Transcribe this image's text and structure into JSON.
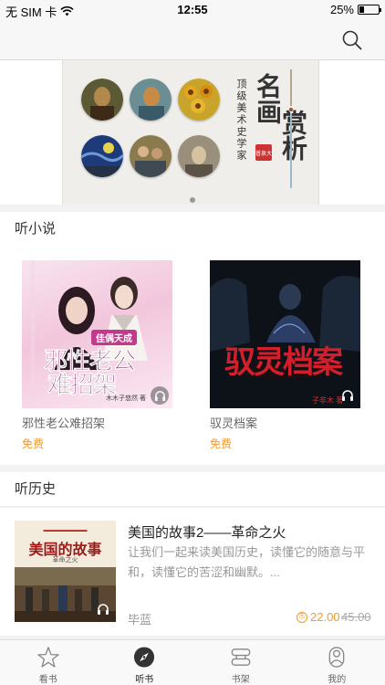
{
  "status_bar": {
    "carrier": "无 SIM 卡",
    "time": "12:55",
    "battery_text": "25%",
    "battery_level": 0.25
  },
  "header": {
    "search_icon": "search-icon"
  },
  "banner": {
    "title_left": "名画",
    "title_right": "赏析",
    "subtitle": "顶级美术史学家",
    "seal_text": "普泉大",
    "paintings": [
      "mona-lisa",
      "van-gogh-self-portrait",
      "sunflowers",
      "starry-night",
      "renoir-dancers",
      "portrait"
    ],
    "active_dot": 0
  },
  "novels": {
    "section_title": "听小说",
    "books": [
      {
        "title": "邪性老公难招架",
        "price": "免费",
        "cover_tag": "佳偶天成",
        "cover_title_1": "邪性老公",
        "cover_title_2": "难招架",
        "cover_author": "木木子悠然 著",
        "accent": "#c23a8a"
      },
      {
        "title": "驭灵档案",
        "price": "免费",
        "cover_title": "驭灵档案",
        "cover_author": "子非木 著",
        "accent": "#d31f2b"
      }
    ]
  },
  "history": {
    "section_title": "听历史",
    "item": {
      "title": "美国的故事2——革命之火",
      "description": "让我们一起来读美国历史，读懂它的随意与平和，读懂它的苦涩和幽默。...",
      "author": "毕蓝",
      "price_now": "22.00",
      "price_old": "45.00",
      "cover_title": "美国的故事",
      "cover_sub": "革命之火"
    }
  },
  "tabbar": {
    "tabs": [
      {
        "label": "看书",
        "icon": "star-icon"
      },
      {
        "label": "听书",
        "icon": "compass-icon",
        "active": true
      },
      {
        "label": "书架",
        "icon": "bookshelf-icon"
      },
      {
        "label": "我的",
        "icon": "person-icon"
      }
    ]
  }
}
